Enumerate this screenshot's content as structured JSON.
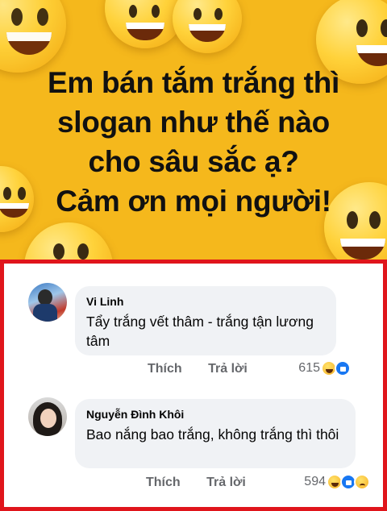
{
  "post": {
    "text_lines": [
      "Em bán tắm trắng thì",
      "slogan như thế nào",
      "cho sâu sắc ạ?",
      "Cảm ơn mọi người!"
    ],
    "background_color": "#f5b81c",
    "decoration_icon": "grinning-face-emoji"
  },
  "highlight_color": "#e0151b",
  "comments": [
    {
      "author": "Vi Linh",
      "text": "Tẩy trắng vết thâm - trắng tận lương tâm",
      "actions": {
        "like_label": "Thích",
        "reply_label": "Trả lời"
      },
      "reaction_count": "615",
      "reaction_icons": [
        "haha-reaction-icon",
        "like-reaction-icon"
      ]
    },
    {
      "author": "Nguyễn Đình Khôi",
      "text": "Bao nắng bao trắng, không trắng thì thôi",
      "actions": {
        "like_label": "Thích",
        "reply_label": "Trả lời"
      },
      "reaction_count": "594",
      "reaction_icons": [
        "haha-reaction-icon",
        "like-reaction-icon",
        "sad-reaction-icon"
      ]
    }
  ],
  "colors": {
    "bubble_bg": "#f0f2f5",
    "action_text": "#65676b",
    "like_blue": "#1877f2"
  }
}
